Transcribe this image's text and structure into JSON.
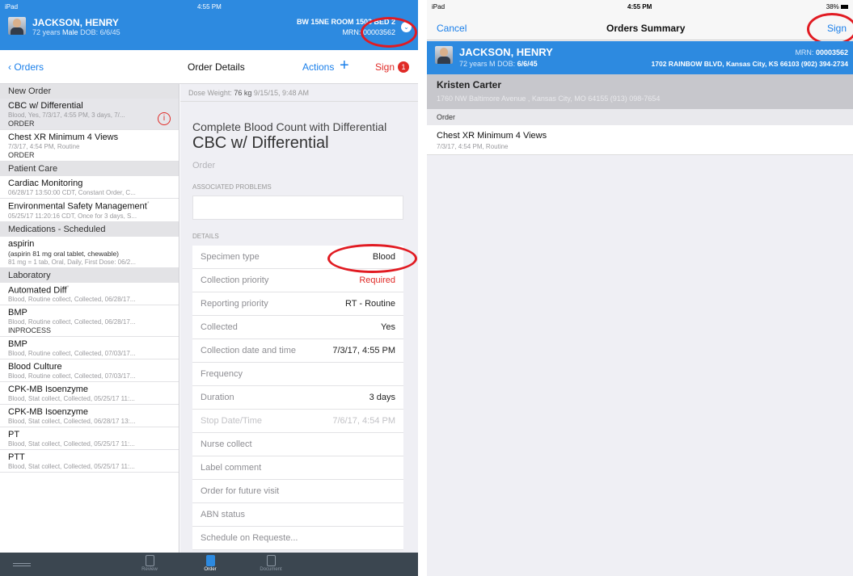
{
  "left": {
    "status": {
      "carrier": "iPad",
      "time": "4:55 PM"
    },
    "patient": {
      "name": "JACKSON, HENRY",
      "age": "72 years",
      "sex": "Male",
      "dob_label": "DOB:",
      "dob": "6/6/45",
      "location": "BW 15NE ROOM 15",
      "location_tail": "03 BED 2",
      "mrn_label": "MRN:",
      "mrn": "00003562"
    },
    "nav": {
      "back": "Orders",
      "title": "Order Details",
      "actions": "Actions",
      "plus": "+",
      "sign": "Sign",
      "sign_badge": "1"
    },
    "list": [
      {
        "section": "New Order"
      },
      {
        "title": "CBC w/ Differential",
        "sub": "Blood, Yes, 7/3/17, 4:55 PM, 3 days, 7/...",
        "kind": "ORDER",
        "selected": true,
        "alert": "i"
      },
      {
        "title": "Chest XR Minimum 4 Views",
        "sub": "7/3/17, 4:54 PM, Routine",
        "kind": "ORDER"
      },
      {
        "section": "Patient Care"
      },
      {
        "title": "Cardiac Monitoring",
        "sub": "06/28/17 13:50:00 CDT, Constant Order, C..."
      },
      {
        "title": "Environmental Safety Management",
        "star": "*",
        "sub": "05/25/17 11:20:16 CDT, Once for 3 days, S..."
      },
      {
        "section": "Medications - Scheduled"
      },
      {
        "title": "aspirin",
        "sub2": "(aspirin 81 mg oral tablet, chewable)",
        "sub": "81 mg = 1 tab, Oral, Daily, First Dose: 06/2..."
      },
      {
        "section": "Laboratory"
      },
      {
        "title": "Automated Diff",
        "star": "*",
        "sub": "Blood, Routine collect, Collected, 06/28/17..."
      },
      {
        "title": "BMP",
        "sub": "Blood, Routine collect, Collected, 06/28/17...",
        "kind": "INPROCESS"
      },
      {
        "title": "BMP",
        "sub": "Blood, Routine collect, Collected, 07/03/17..."
      },
      {
        "title": "Blood Culture",
        "sub": "Blood, Routine collect, Collected, 07/03/17..."
      },
      {
        "title": "CPK-MB Isoenzyme",
        "sub": "Blood, Stat collect, Collected, 05/25/17 11:..."
      },
      {
        "title": "CPK-MB Isoenzyme",
        "sub": "Blood, Stat collect, Collected, 06/28/17 13:..."
      },
      {
        "title": "PT",
        "sub": "Blood, Stat collect, Collected, 05/25/17 11:..."
      },
      {
        "title": "PTT",
        "sub": "Blood, Stat collect, Collected, 05/25/17 11:..."
      }
    ],
    "detail": {
      "dose_label": "Dose Weight:",
      "dose_value": "76 kg",
      "dose_time": "9/15/15, 9:48 AM",
      "full_name": "Complete Blood Count with Differential",
      "short_name": "CBC w/ Differential",
      "type": "Order",
      "problems_header": "ASSOCIATED PROBLEMS",
      "details_header": "DETAILS",
      "rows": [
        {
          "label": "Specimen type",
          "value": "Blood"
        },
        {
          "label": "Collection priority",
          "value": "Required",
          "required": true
        },
        {
          "label": "Reporting priority",
          "value": "RT - Routine"
        },
        {
          "label": "Collected",
          "value": "Yes"
        },
        {
          "label": "Collection date and time",
          "value": "7/3/17, 4:55 PM"
        },
        {
          "label": "Frequency",
          "value": ""
        },
        {
          "label": "Duration",
          "value": "3 days"
        },
        {
          "label": "Stop Date/Time",
          "value": "7/6/17, 4:54 PM",
          "dim": true
        },
        {
          "label": "Nurse collect",
          "value": ""
        },
        {
          "label": "Label comment",
          "value": ""
        },
        {
          "label": "Order for future visit",
          "value": ""
        },
        {
          "label": "ABN status",
          "value": ""
        },
        {
          "label": "Schedule on Requeste...",
          "value": ""
        }
      ]
    },
    "tabs": {
      "review": "Review",
      "order": "Order",
      "document": "Document"
    }
  },
  "right": {
    "status": {
      "carrier": "iPad",
      "time": "4:55 PM",
      "battery": "38%"
    },
    "nav": {
      "cancel": "Cancel",
      "title": "Orders Summary",
      "sign": "Sign"
    },
    "patient": {
      "name": "JACKSON, HENRY",
      "age": "72 years",
      "sex": "M",
      "dob_label": "DOB:",
      "dob": "6/6/45",
      "mrn_label": "MRN:",
      "mrn": "00003562",
      "address": "1702 RAINBOW BLVD, Kansas City, KS 66103 (902) 394-2734"
    },
    "pharmacy": {
      "name": "Kristen Carter",
      "address": "1760 NW Baltimore Avenue , Kansas City, MO 64155 (913) 098-7654"
    },
    "section": "Order",
    "order": {
      "title": "Chest XR Minimum 4 Views",
      "sub": "7/3/17, 4:54 PM, Routine"
    }
  },
  "colors": {
    "brand_blue": "#2d8ae0",
    "ios_blue": "#1a7fea",
    "alert_red": "#e02b27",
    "annotation_red": "#e11b22"
  }
}
